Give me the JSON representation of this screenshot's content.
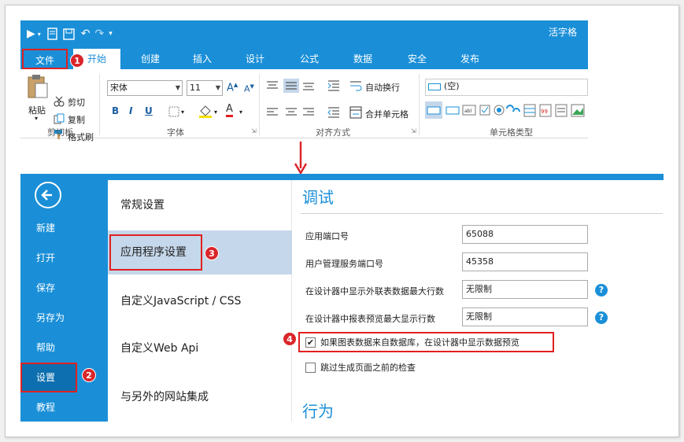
{
  "ribbon": {
    "app_title": "活字格",
    "tabs": [
      {
        "label": "文件"
      },
      {
        "label": "开始"
      },
      {
        "label": "创建"
      },
      {
        "label": "插入"
      },
      {
        "label": "设计"
      },
      {
        "label": "公式"
      },
      {
        "label": "数据"
      },
      {
        "label": "安全"
      },
      {
        "label": "发布"
      }
    ],
    "clipboard": {
      "paste": "粘贴",
      "cut": "剪切",
      "copy": "复制",
      "format_painter": "格式刷",
      "group_label": "剪切板"
    },
    "font": {
      "font_name": "宋体",
      "font_size": "11",
      "group_label": "字体"
    },
    "alignment": {
      "wrap_text": "自动换行",
      "merge_cells": "合并单元格",
      "group_label": "对齐方式"
    },
    "cell_type": {
      "current": "(空)",
      "group_label": "单元格类型"
    }
  },
  "backstage": {
    "nav": [
      {
        "label": "新建"
      },
      {
        "label": "打开"
      },
      {
        "label": "保存"
      },
      {
        "label": "另存为"
      },
      {
        "label": "帮助"
      },
      {
        "label": "设置"
      },
      {
        "label": "教程"
      }
    ],
    "settings_menu": [
      {
        "label": "常规设置"
      },
      {
        "label": "应用程序设置"
      },
      {
        "label": "自定义JavaScript / CSS"
      },
      {
        "label": "自定义Web Api"
      },
      {
        "label": "与另外的网站集成"
      }
    ],
    "debug": {
      "title": "调试",
      "fields": [
        {
          "label": "应用端口号",
          "value": "65088"
        },
        {
          "label": "用户管理服务端口号",
          "value": "45358"
        },
        {
          "label": "在设计器中显示外联表数据最大行数",
          "value": "无限制"
        },
        {
          "label": "在设计器中报表预览最大显示行数",
          "value": "无限制"
        }
      ],
      "checkbox_preview": {
        "label": "如果图表数据来自数据库，在设计器中显示数据预览",
        "checked": true
      },
      "checkbox_skip": {
        "label": "跳过生成页面之前的检查",
        "checked": false
      }
    },
    "behavior": {
      "title": "行为"
    }
  },
  "badges": [
    "1",
    "2",
    "3",
    "4"
  ],
  "colors": {
    "accent": "#1a8fd8",
    "highlight_border": "#e02020",
    "badge": "#d9262a",
    "selected_menu": "#c5d7ea"
  }
}
